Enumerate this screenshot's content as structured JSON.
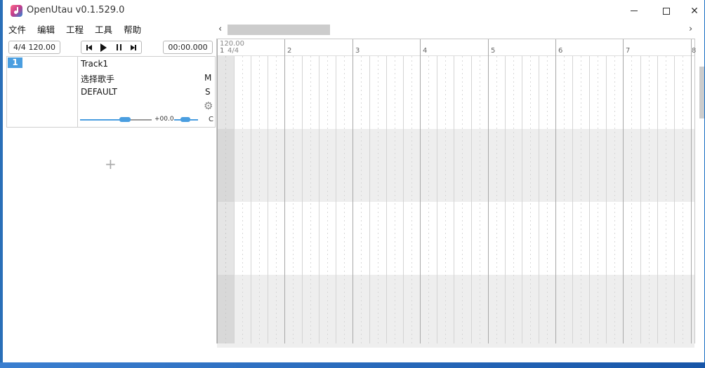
{
  "window": {
    "title": "OpenUtau v0.1.529.0"
  },
  "menu": {
    "items": [
      "文件",
      "编辑",
      "工程",
      "工具",
      "帮助"
    ]
  },
  "toolbar": {
    "time_signature": "4/4",
    "tempo": "120.00",
    "clock": "00:00.000",
    "transport": [
      "skip-to-start",
      "play",
      "pause",
      "skip-to-end"
    ]
  },
  "track": {
    "number": "1",
    "name": "Track1",
    "singer": "选择歌手",
    "phonemizer": "DEFAULT",
    "mute_label": "M",
    "solo_label": "S",
    "volume_value": "+00.0",
    "pan_label": "C",
    "volume_level": 0.6,
    "pan_level": 0.5,
    "add_icon": "plus-icon",
    "settings_icon": "gear-icon"
  },
  "timeline": {
    "tempo_marker": "120.00",
    "first_bar": "1",
    "signature_marker": "4/4",
    "bars": [
      "2",
      "3",
      "4",
      "5",
      "6",
      "7",
      "8"
    ]
  },
  "scrollbars": {
    "left_arrow": "‹",
    "right_arrow": "›"
  },
  "colors": {
    "accent": "#4a9ee0",
    "desktop": "#1a6fc4"
  }
}
